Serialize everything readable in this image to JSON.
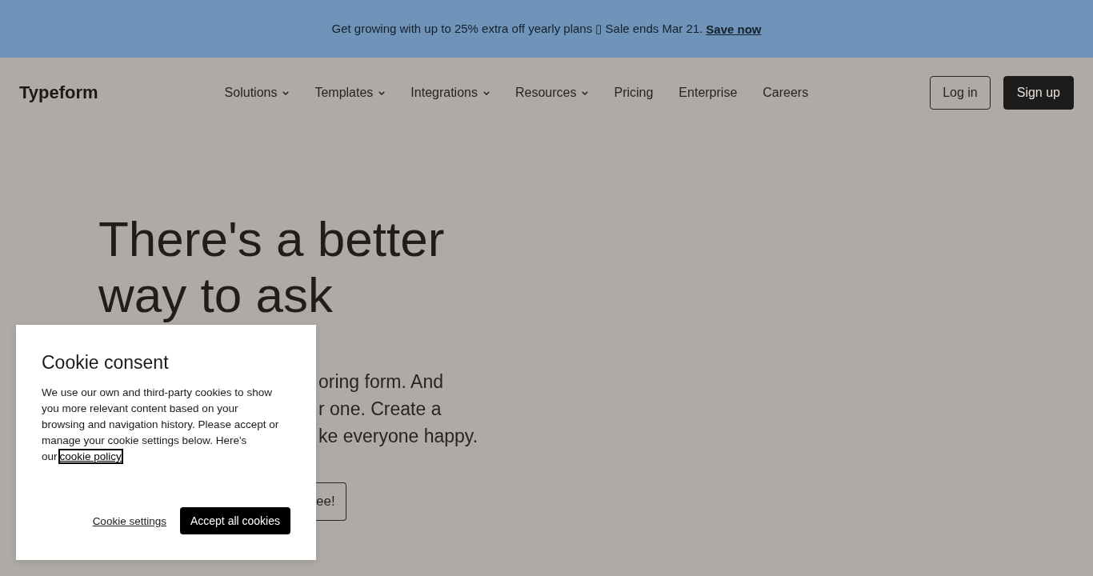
{
  "promo_banner": {
    "text": "Get growing with up to 25% extra off yearly plans ▯ Sale ends Mar 21.",
    "link": "Save now"
  },
  "header": {
    "logo": "Typeform",
    "nav": [
      {
        "label": "Solutions",
        "kind": "dropdown"
      },
      {
        "label": "Templates",
        "kind": "dropdown"
      },
      {
        "label": "Integrations",
        "kind": "dropdown"
      },
      {
        "label": "Resources",
        "kind": "dropdown"
      },
      {
        "label": "Pricing",
        "kind": "link"
      },
      {
        "label": "Enterprise",
        "kind": "link"
      },
      {
        "label": "Careers",
        "kind": "link"
      }
    ],
    "buttons": [
      {
        "label": "Log in",
        "kind": "outline"
      },
      {
        "label": "Sign up",
        "kind": "filled"
      }
    ]
  },
  "hero": {
    "heading_lines": [
      "There's a better",
      "way to ask"
    ],
    "text_lines": [
      "oring form. And",
      "r one. Create a",
      "ke everyone happy."
    ],
    "button": "ee!"
  },
  "cookie_dialog": {
    "title": "Cookie consent",
    "text": "We use our own and third-party cookies to show you more relevant content based on your browsing and navigation history. Please accept or manage your cookie settings below. Here's our",
    "link": "cookie policy",
    "buttons": [
      {
        "label": "Cookie settings",
        "kind": "link"
      },
      {
        "label": "Accept all cookies",
        "kind": "primary"
      }
    ]
  }
}
